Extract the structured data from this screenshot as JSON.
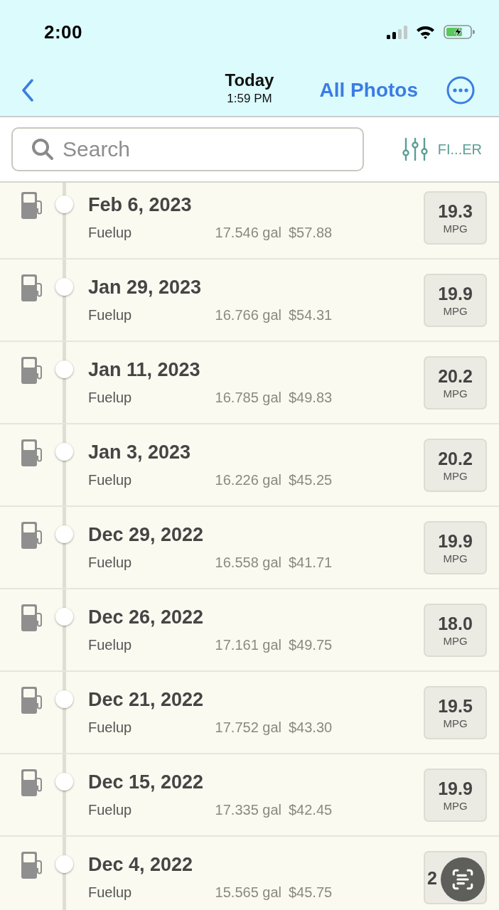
{
  "status_bar": {
    "time": "2:00"
  },
  "nav": {
    "title": "Today",
    "subtitle": "1:59 PM",
    "action": "All Photos"
  },
  "search": {
    "placeholder": "Search"
  },
  "filter": {
    "label": "FI...ER"
  },
  "entries": [
    {
      "date": "Feb 6, 2023",
      "type": "Fuelup",
      "gallons": "17.546 gal",
      "cost": "$57.88",
      "mpg": "19.3",
      "unit": "MPG",
      "covered": false
    },
    {
      "date": "Jan 29, 2023",
      "type": "Fuelup",
      "gallons": "16.766 gal",
      "cost": "$54.31",
      "mpg": "19.9",
      "unit": "MPG",
      "covered": false
    },
    {
      "date": "Jan 11, 2023",
      "type": "Fuelup",
      "gallons": "16.785 gal",
      "cost": "$49.83",
      "mpg": "20.2",
      "unit": "MPG",
      "covered": false
    },
    {
      "date": "Jan 3, 2023",
      "type": "Fuelup",
      "gallons": "16.226 gal",
      "cost": "$45.25",
      "mpg": "20.2",
      "unit": "MPG",
      "covered": false
    },
    {
      "date": "Dec 29, 2022",
      "type": "Fuelup",
      "gallons": "16.558 gal",
      "cost": "$41.71",
      "mpg": "19.9",
      "unit": "MPG",
      "covered": false
    },
    {
      "date": "Dec 26, 2022",
      "type": "Fuelup",
      "gallons": "17.161 gal",
      "cost": "$49.75",
      "mpg": "18.0",
      "unit": "MPG",
      "covered": false
    },
    {
      "date": "Dec 21, 2022",
      "type": "Fuelup",
      "gallons": "17.752 gal",
      "cost": "$43.30",
      "mpg": "19.5",
      "unit": "MPG",
      "covered": false
    },
    {
      "date": "Dec 15, 2022",
      "type": "Fuelup",
      "gallons": "17.335 gal",
      "cost": "$42.45",
      "mpg": "19.9",
      "unit": "MPG",
      "covered": false
    },
    {
      "date": "Dec 4, 2022",
      "type": "Fuelup",
      "gallons": "15.565 gal",
      "cost": "$45.75",
      "mpg": "2",
      "covered": true
    }
  ]
}
